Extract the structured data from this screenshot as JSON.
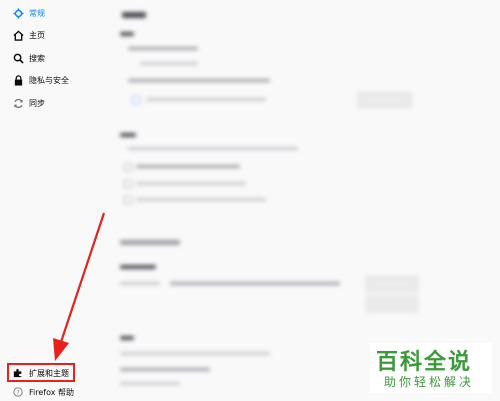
{
  "sidebar": {
    "items": [
      {
        "label": "常规",
        "icon": "gear-icon",
        "selected": true
      },
      {
        "label": "主页",
        "icon": "home-icon"
      },
      {
        "label": "搜索",
        "icon": "search-icon"
      },
      {
        "label": "隐私与安全",
        "icon": "lock-icon"
      },
      {
        "label": "同步",
        "icon": "sync-icon"
      }
    ],
    "bottom_items": [
      {
        "label": "扩展和主题",
        "icon": "puzzle-icon"
      },
      {
        "label": "Firefox 帮助",
        "icon": "help-icon"
      }
    ]
  },
  "watermark": {
    "title": "百科全说",
    "subtitle": "助你轻松解决"
  },
  "colors": {
    "accent": "#0a84ff",
    "annotation": "#e8221b",
    "watermark": "#3a9a3a"
  }
}
